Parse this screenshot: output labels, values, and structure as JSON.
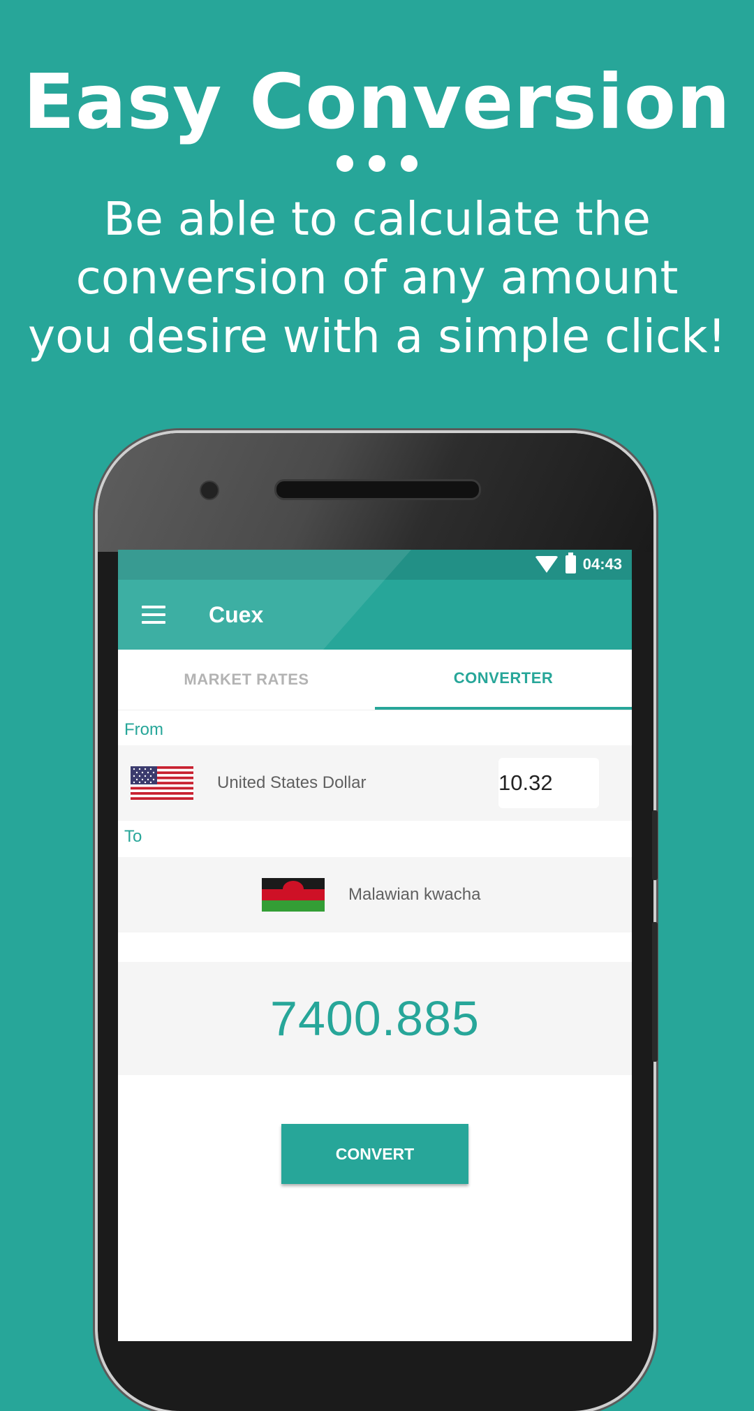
{
  "promo": {
    "title": "Easy Conversion",
    "subtitle": "Be able to calculate the conversion of any amount you desire with a simple click!"
  },
  "status_bar": {
    "time": "04:43"
  },
  "app_bar": {
    "title": "Cuex"
  },
  "tabs": [
    {
      "label": "MARKET RATES",
      "active": false
    },
    {
      "label": "CONVERTER",
      "active": true
    }
  ],
  "converter": {
    "from_label": "From",
    "from_currency": "United States Dollar",
    "amount": "10.32",
    "to_label": "To",
    "to_currency": "Malawian kwacha",
    "result": "7400.885",
    "convert_label": "CONVERT"
  },
  "colors": {
    "accent": "#27a699",
    "status_bar": "#229086",
    "row_bg": "#f5f5f5"
  }
}
